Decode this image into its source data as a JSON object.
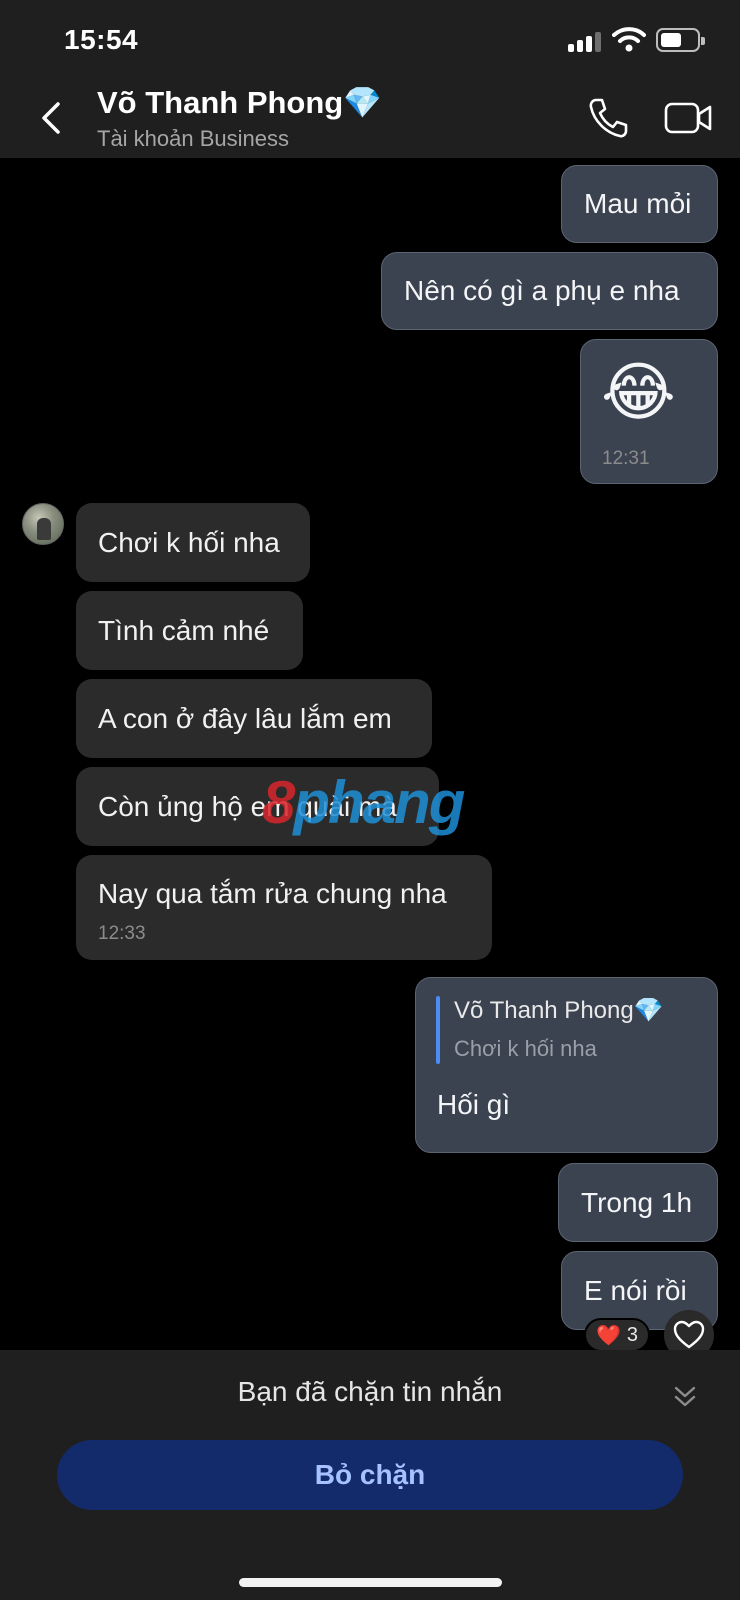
{
  "status_bar": {
    "time": "15:54"
  },
  "header": {
    "contact_name": "Võ Thanh Phong💎",
    "subtitle": "Tài khoản Business"
  },
  "messages": {
    "m1": "Mau mỏi",
    "m2": "Nên có gì a phụ e nha",
    "m3_emoji": "😂",
    "m3_time": "12:31",
    "m4": "Chơi k hối nha",
    "m5": "Tình cảm nhé",
    "m6": "A con ở đây lâu lắm em",
    "m7": "Còn ủng hộ em quài mà",
    "m8": "Nay qua tắm rửa chung nha",
    "m8_time": "12:33",
    "reply_name": "Võ Thanh Phong💎",
    "reply_quote": "Chơi k hối nha",
    "m9": "Hối gì",
    "m10": "Trong 1h",
    "m11": "E nói rồi",
    "reaction_emoji": "❤️",
    "reaction_count": "3"
  },
  "watermark": {
    "part1": "8",
    "part2": "phang"
  },
  "footer": {
    "blocked_text": "Bạn đã chặn tin nhắn",
    "unblock_label": "Bỏ chặn"
  },
  "colors": {
    "outgoing_bubble": "#3b4250",
    "incoming_bubble": "#2b2b2b",
    "unblock_button": "#132a6b",
    "unblock_text": "#a6c2ff"
  }
}
